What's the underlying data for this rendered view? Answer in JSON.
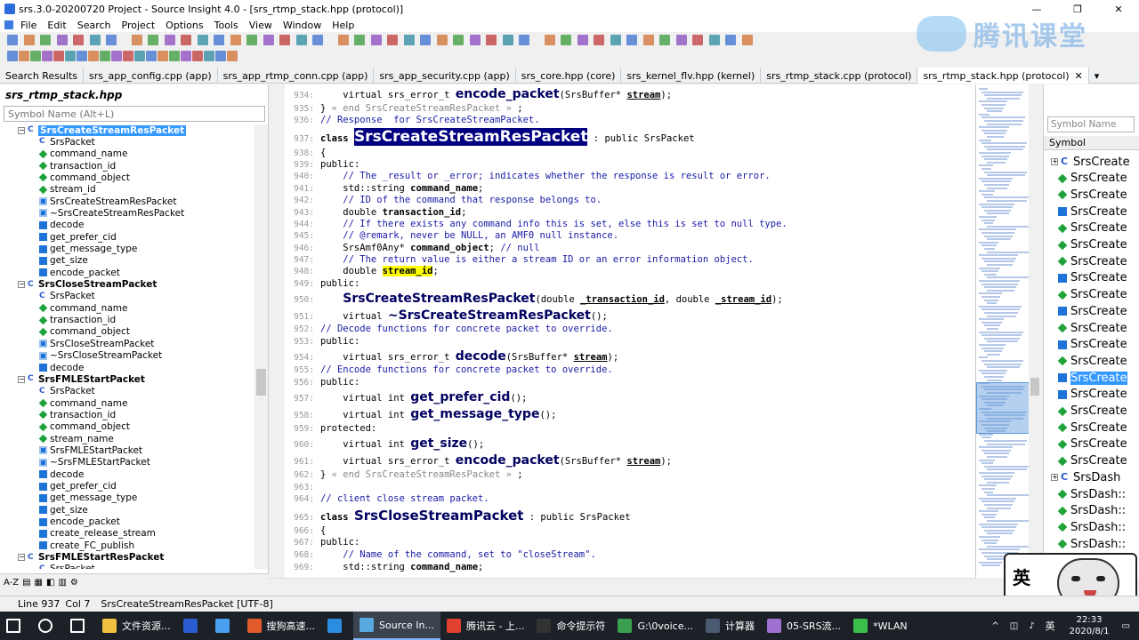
{
  "window": {
    "title": "srs.3.0-20200720 Project - Source Insight 4.0 - [srs_rtmp_stack.hpp (protocol)]"
  },
  "menu": [
    "File",
    "Edit",
    "Search",
    "Project",
    "Options",
    "Tools",
    "View",
    "Window",
    "Help"
  ],
  "tabs": [
    "Search Results",
    "srs_app_config.cpp (app)",
    "srs_app_rtmp_conn.cpp (app)",
    "srs_app_security.cpp (app)",
    "srs_core.hpp (core)",
    "srs_kernel_flv.hpp (kernel)",
    "srs_rtmp_stack.cpp (protocol)",
    "srs_rtmp_stack.hpp (protocol)"
  ],
  "left_panel": {
    "title": "srs_rtmp_stack.hpp",
    "search_placeholder": "Symbol Name (Alt+L)",
    "tree": [
      {
        "label": "SrsCreateStreamResPacket",
        "kind": "class",
        "level": 0,
        "selected": true
      },
      {
        "label": "SrsPacket",
        "kind": "class",
        "level": 1
      },
      {
        "label": "command_name",
        "kind": "member",
        "level": 1
      },
      {
        "label": "transaction_id",
        "kind": "member",
        "level": 1
      },
      {
        "label": "command_object",
        "kind": "member",
        "level": 1
      },
      {
        "label": "stream_id",
        "kind": "member",
        "level": 1
      },
      {
        "label": "SrsCreateStreamResPacket",
        "kind": "ctor",
        "level": 1
      },
      {
        "label": "~SrsCreateStreamResPacket",
        "kind": "ctor",
        "level": 1
      },
      {
        "label": "decode",
        "kind": "func",
        "level": 1
      },
      {
        "label": "get_prefer_cid",
        "kind": "func",
        "level": 1
      },
      {
        "label": "get_message_type",
        "kind": "func",
        "level": 1
      },
      {
        "label": "get_size",
        "kind": "func",
        "level": 1
      },
      {
        "label": "encode_packet",
        "kind": "func",
        "level": 1
      },
      {
        "label": "SrsCloseStreamPacket",
        "kind": "class",
        "level": 0
      },
      {
        "label": "SrsPacket",
        "kind": "class",
        "level": 1
      },
      {
        "label": "command_name",
        "kind": "member",
        "level": 1
      },
      {
        "label": "transaction_id",
        "kind": "member",
        "level": 1
      },
      {
        "label": "command_object",
        "kind": "member",
        "level": 1
      },
      {
        "label": "SrsCloseStreamPacket",
        "kind": "ctor",
        "level": 1
      },
      {
        "label": "~SrsCloseStreamPacket",
        "kind": "ctor",
        "level": 1
      },
      {
        "label": "decode",
        "kind": "func",
        "level": 1
      },
      {
        "label": "SrsFMLEStartPacket",
        "kind": "class",
        "level": 0
      },
      {
        "label": "SrsPacket",
        "kind": "class",
        "level": 1
      },
      {
        "label": "command_name",
        "kind": "member",
        "level": 1
      },
      {
        "label": "transaction_id",
        "kind": "member",
        "level": 1
      },
      {
        "label": "command_object",
        "kind": "member",
        "level": 1
      },
      {
        "label": "stream_name",
        "kind": "member",
        "level": 1
      },
      {
        "label": "SrsFMLEStartPacket",
        "kind": "ctor",
        "level": 1
      },
      {
        "label": "~SrsFMLEStartPacket",
        "kind": "ctor",
        "level": 1
      },
      {
        "label": "decode",
        "kind": "func",
        "level": 1
      },
      {
        "label": "get_prefer_cid",
        "kind": "func",
        "level": 1
      },
      {
        "label": "get_message_type",
        "kind": "func",
        "level": 1
      },
      {
        "label": "get_size",
        "kind": "func",
        "level": 1
      },
      {
        "label": "encode_packet",
        "kind": "func",
        "level": 1
      },
      {
        "label": "create_release_stream",
        "kind": "func",
        "level": 1
      },
      {
        "label": "create_FC_publish",
        "kind": "func",
        "level": 1
      },
      {
        "label": "SrsFMLEStartResPacket",
        "kind": "class",
        "level": 0
      },
      {
        "label": "SrsPacket",
        "kind": "class",
        "level": 1
      }
    ]
  },
  "editor": {
    "lines": [
      {
        "n": "934:",
        "html": "    <span class='kw'>virtual</span> <span class='kw'>srs_error_t</span> <span class='hdr' style='font-size:14px'>encode_packet</span>(<span>SrsBuffer*</span> <b style='text-decoration:underline'>stream</b>);"
      },
      {
        "n": "935:",
        "html": "} <span class='lb'>&laquo; end SrsCreateStreamResPacket &raquo;</span> ;"
      },
      {
        "n": "936:",
        "html": "<span class='cm'>// Response  for SrsCreateStreamPacket.</span>"
      },
      {
        "n": "937:",
        "html": "<span class='kw' style='font-weight:bold'>class</span> <span class='hdr' style='font-size:17px;background:#000080;color:#fff'>SrsCreateStreamResPacket</span> : <span class='kw'>public</span> SrsPacket"
      },
      {
        "n": "938:",
        "html": "{"
      },
      {
        "n": "939:",
        "html": "<span class='kw'>public</span>:"
      },
      {
        "n": "940:",
        "html": "    <span class='cm'>// The _result or _error; indicates whether the response is result or error.</span>"
      },
      {
        "n": "941:",
        "html": "    std::string <b>command_name</b>;"
      },
      {
        "n": "942:",
        "html": "    <span class='cm'>// ID of the command that response belongs to.</span>"
      },
      {
        "n": "943:",
        "html": "    <span class='kw'>double</span> <b>transaction_id</b>;"
      },
      {
        "n": "944:",
        "html": "    <span class='cm'>// If there exists any command info this is set, else this is set to null type.</span>"
      },
      {
        "n": "945:",
        "html": "    <span class='cm'>// @remark, never be NULL, an AMF0 null instance.</span>"
      },
      {
        "n": "946:",
        "html": "    SrsAmf0Any* <b>command_object</b>; <span class='cm'>// null</span>"
      },
      {
        "n": "947:",
        "html": "    <span class='cm'>// The return value is either a stream ID or an error information object.</span>"
      },
      {
        "n": "948:",
        "html": "    <span class='kw'>double</span> <b style='background:#ffff00'>stream_id</b>;"
      },
      {
        "n": "949:",
        "html": "<span class='kw'>public</span>:"
      },
      {
        "n": "950:",
        "html": "    <span class='hdr' style='font-size:14px'>SrsCreateStreamResPacket</span>(<span class='kw'>double</span> <b style='text-decoration:underline'>_transaction_id</b>, <span class='kw'>double</span> <b style='text-decoration:underline'>_stream_id</b>);"
      },
      {
        "n": "951:",
        "html": "    <span class='kw'>virtual</span> <span class='hdr' style='font-size:14px'>~SrsCreateStreamResPacket</span>();"
      },
      {
        "n": "952:",
        "html": "<span class='cm'>// Decode functions for concrete packet to override.</span>"
      },
      {
        "n": "953:",
        "html": "<span class='kw'>public</span>:"
      },
      {
        "n": "954:",
        "html": "    <span class='kw'>virtual</span> <span class='kw'>srs_error_t</span> <span class='hdr' style='font-size:14px'>decode</span>(SrsBuffer* <b style='text-decoration:underline'>stream</b>);"
      },
      {
        "n": "955:",
        "html": "<span class='cm'>// Encode functions for concrete packet to override.</span>"
      },
      {
        "n": "956:",
        "html": "<span class='kw'>public</span>:"
      },
      {
        "n": "957:",
        "html": "    <span class='kw'>virtual</span> <span class='kw'>int</span> <span class='hdr' style='font-size:14px'>get_prefer_cid</span>();"
      },
      {
        "n": "958:",
        "html": "    <span class='kw'>virtual</span> <span class='kw'>int</span> <span class='hdr' style='font-size:14px'>get_message_type</span>();"
      },
      {
        "n": "959:",
        "html": "<span class='kw'>protected</span>:"
      },
      {
        "n": "960:",
        "html": "    <span class='kw'>virtual</span> <span class='kw'>int</span> <span class='hdr' style='font-size:14px'>get_size</span>();"
      },
      {
        "n": "961:",
        "html": "    <span class='kw'>virtual</span> <span class='kw'>srs_error_t</span> <span class='hdr' style='font-size:14px'>encode_packet</span>(SrsBuffer* <b style='text-decoration:underline'>stream</b>);"
      },
      {
        "n": "962:",
        "html": "} <span class='lb'>&laquo; end SrsCreateStreamResPacket &raquo;</span> ;"
      },
      {
        "n": "963:",
        "html": ""
      },
      {
        "n": "964:",
        "html": "<span class='cm'>// client close stream packet.</span>"
      },
      {
        "n": "965:",
        "html": "<span class='kw' style='font-weight:bold'>class</span> <span class='hdr' style='font-size:15px'>SrsCloseStreamPacket</span> : <span class='kw'>public</span> SrsPacket"
      },
      {
        "n": "966:",
        "html": "{"
      },
      {
        "n": "967:",
        "html": "<span class='kw'>public</span>:"
      },
      {
        "n": "968:",
        "html": "    <span class='cm'>// Name of the command, set to \"closeStream\".</span>"
      },
      {
        "n": "969:",
        "html": "    std::string <b>command_name</b>;"
      }
    ],
    "line_tops": [
      4,
      20,
      33,
      52,
      70,
      83,
      96,
      110,
      123,
      137,
      150,
      163,
      177,
      190,
      203,
      217,
      234,
      253,
      268,
      282,
      299,
      314,
      328,
      345,
      364,
      380,
      397,
      416,
      432,
      446,
      459,
      478,
      495,
      508,
      522,
      536
    ]
  },
  "right_panel": {
    "search_placeholder": "Symbol Name",
    "header": "Symbol",
    "items": [
      {
        "label": "SrsCreate",
        "kind": "class"
      },
      {
        "label": "SrsCreate",
        "kind": "member"
      },
      {
        "label": "SrsCreate",
        "kind": "member"
      },
      {
        "label": "SrsCreate",
        "kind": "func"
      },
      {
        "label": "SrsCreate",
        "kind": "member"
      },
      {
        "label": "SrsCreate",
        "kind": "member"
      },
      {
        "label": "SrsCreate",
        "kind": "member"
      },
      {
        "label": "SrsCreate",
        "kind": "func"
      },
      {
        "label": "SrsCreate",
        "kind": "member"
      },
      {
        "label": "SrsCreate",
        "kind": "func"
      },
      {
        "label": "SrsCreate",
        "kind": "member"
      },
      {
        "label": "SrsCreate",
        "kind": "func"
      },
      {
        "label": "SrsCreate",
        "kind": "member"
      },
      {
        "label": "SrsCreate",
        "kind": "func",
        "selected": true
      },
      {
        "label": "SrsCreate",
        "kind": "func"
      },
      {
        "label": "SrsCreate",
        "kind": "member"
      },
      {
        "label": "SrsCreate",
        "kind": "member"
      },
      {
        "label": "SrsCreate",
        "kind": "member"
      },
      {
        "label": "SrsCreate",
        "kind": "member"
      },
      {
        "label": "SrsDash",
        "kind": "class"
      },
      {
        "label": "SrsDash::",
        "kind": "member"
      },
      {
        "label": "SrsDash::",
        "kind": "member"
      },
      {
        "label": "SrsDash::",
        "kind": "member"
      },
      {
        "label": "SrsDash::",
        "kind": "member"
      }
    ]
  },
  "status": {
    "line": "Line 937",
    "col": "Col 7",
    "symbol": "SrsCreateStreamResPacket [UTF-8]"
  },
  "watermark": "腾讯课堂",
  "camera": {
    "ime_label": "英"
  },
  "taskbar": {
    "items": [
      {
        "label": "",
        "icon": "windows-icon"
      },
      {
        "label": "",
        "icon": "search-icon"
      },
      {
        "label": "",
        "icon": "task-view-icon"
      },
      {
        "label": "文件资源...",
        "icon": "folder-icon"
      },
      {
        "label": "",
        "icon": "word-icon"
      },
      {
        "label": "",
        "icon": "browser-icon"
      },
      {
        "label": "搜狗高速...",
        "icon": "sogou-icon"
      },
      {
        "label": "",
        "icon": "vscode-icon"
      },
      {
        "label": "Source In...",
        "icon": "sourceinsight-icon",
        "active": true
      },
      {
        "label": "腾讯云 - 上...",
        "icon": "chrome-icon"
      },
      {
        "label": "命令提示符",
        "icon": "cmd-icon"
      },
      {
        "label": "G:\\0voice...",
        "icon": "notepad-icon"
      },
      {
        "label": "计算器",
        "icon": "calculator-icon"
      },
      {
        "label": "05-SRS流...",
        "icon": "app-icon"
      },
      {
        "label": "*WLAN",
        "icon": "wireshark-icon"
      }
    ],
    "time": "22:33",
    "date": "2020/8/1",
    "ime": "英"
  },
  "colors": {
    "class_icon": "#2b5bd0",
    "member_icon": "#1ea23a",
    "func_icon": "#1e73d8",
    "selection": "#3399ff",
    "header_highlight": "#000080",
    "search_highlight": "#ffff00"
  }
}
